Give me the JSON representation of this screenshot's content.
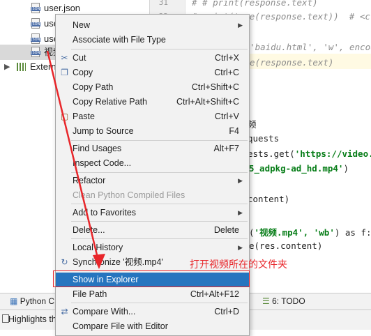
{
  "project_tree": {
    "files": [
      {
        "name": "user.json",
        "icon": "json-file-icon",
        "badge": "JSON"
      },
      {
        "name": "use",
        "icon": "json-file-icon",
        "badge": "JSON"
      },
      {
        "name": "use",
        "icon": "json-file-icon",
        "badge": "JSON"
      },
      {
        "name": "视频",
        "icon": "json-file-icon",
        "badge": "JSON"
      }
    ],
    "external_libraries": "Externa"
  },
  "editor": {
    "line_numbers": [
      "31",
      "32"
    ],
    "lines": [
      {
        "text": "# # print(response.text)",
        "kind": "comment"
      },
      {
        "text": "# print(type(response.text))  # <cla",
        "kind": "comment"
      },
      {
        "text": "",
        "kind": "plain"
      },
      {
        "text": "n('baidu.html', 'w', encod",
        "kind": "comment"
      },
      {
        "text": "ite(response.text)",
        "kind": "comment"
      },
      {
        "text": "频",
        "kind": "plain"
      },
      {
        "text": "quests",
        "kind": "plain"
      },
      {
        "text": "ests.get('https://video.",
        "kind": "mixed",
        "prefix": "ests.get(",
        "str": "'https://video."
      },
      {
        "text": "5_adpkg-ad_hd.mp4')",
        "kind": "mixed",
        "prefix": "",
        "str": "5_adpkg-ad_hd.mp4'",
        "suffix": ")"
      },
      {
        "text": "content)",
        "kind": "plain"
      },
      {
        "text": "('视频.mp4', 'wb') as f:",
        "kind": "mixed",
        "prefix": "(",
        "str": "'视频.mp4', 'wb'",
        "suffix": ") as f:"
      },
      {
        "text": "e(res.content)",
        "kind": "plain"
      }
    ]
  },
  "context_menu": {
    "items": [
      {
        "label": "New",
        "shortcut": "",
        "submenu": true,
        "icon": ""
      },
      {
        "label": "Associate with File Type",
        "shortcut": "",
        "icon": ""
      },
      {
        "label": "Cut",
        "shortcut": "Ctrl+X",
        "icon": "scissors-icon"
      },
      {
        "label": "Copy",
        "shortcut": "Ctrl+C",
        "icon": "copy-icon"
      },
      {
        "label": "Copy Path",
        "shortcut": "Ctrl+Shift+C",
        "icon": ""
      },
      {
        "label": "Copy Relative Path",
        "shortcut": "Ctrl+Alt+Shift+C",
        "icon": ""
      },
      {
        "label": "Paste",
        "shortcut": "Ctrl+V",
        "icon": "clipboard-icon"
      },
      {
        "label": "Jump to Source",
        "shortcut": "F4",
        "icon": ""
      },
      {
        "label": "Find Usages",
        "shortcut": "Alt+F7",
        "icon": ""
      },
      {
        "label": "Inspect Code...",
        "shortcut": "",
        "icon": ""
      },
      {
        "label": "Refactor",
        "shortcut": "",
        "submenu": true,
        "icon": ""
      },
      {
        "label": "Clean Python Compiled Files",
        "shortcut": "",
        "disabled": true,
        "icon": ""
      },
      {
        "label": "Add to Favorites",
        "shortcut": "",
        "submenu": true,
        "icon": ""
      },
      {
        "label": "Delete...",
        "shortcut": "Delete",
        "icon": ""
      },
      {
        "label": "Local History",
        "shortcut": "",
        "submenu": true,
        "icon": ""
      },
      {
        "label": "Synchronize '视频.mp4'",
        "shortcut": "",
        "icon": "sync-icon"
      },
      {
        "label": "Show in Explorer",
        "shortcut": "",
        "icon": "",
        "active": true
      },
      {
        "label": "File Path",
        "shortcut": "Ctrl+Alt+F12",
        "icon": ""
      },
      {
        "label": "Compare With...",
        "shortcut": "Ctrl+D",
        "icon": "compare-icon"
      },
      {
        "label": "Compare File with Editor",
        "shortcut": "",
        "icon": ""
      }
    ]
  },
  "annotation": {
    "text": "打开视频所在的文件夹",
    "color": "#e8262a"
  },
  "toolwindow_bar": {
    "python_console": "Python C",
    "todo": "6: TODO"
  },
  "status_bar": {
    "text": "Highlights th"
  }
}
